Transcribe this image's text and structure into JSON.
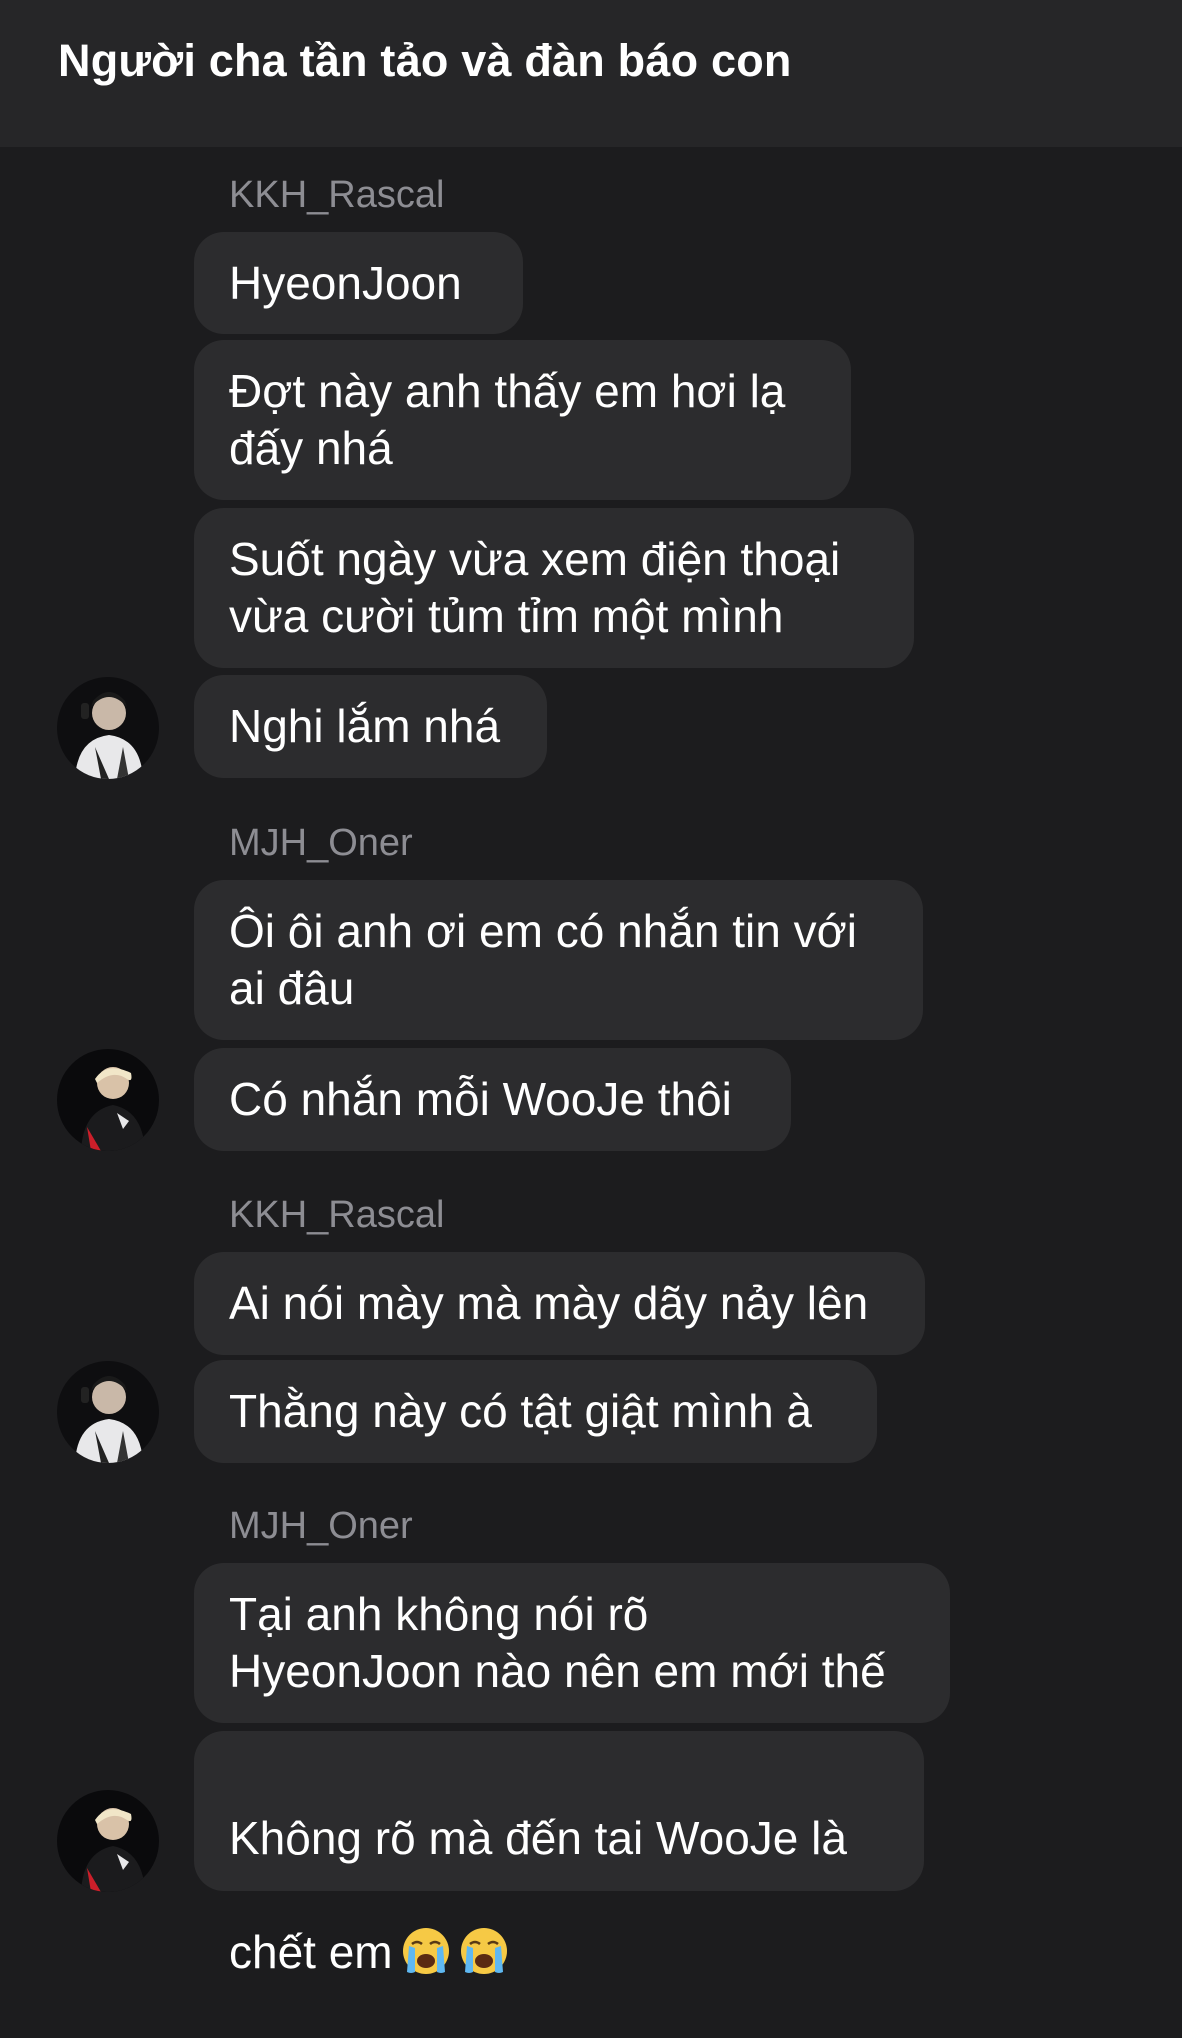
{
  "header": {
    "title": "Người cha tần tảo và đàn báo con"
  },
  "messages": {
    "group1": {
      "sender": "KKH_Rascal",
      "m1": "HyeonJoon",
      "m2": "Đợt này anh thấy em hơi lạ\nđấy nhá",
      "m3": "Suốt ngày vừa xem điện thoại\nvừa cười tủm tỉm một mình",
      "m4": "Nghi lắm nhá"
    },
    "group2": {
      "sender": "MJH_Oner",
      "m1": "Ôi ôi anh ơi em có nhắn tin với\nai đâu",
      "m2": "Có nhắn mỗi WooJe thôi"
    },
    "group3": {
      "sender": "KKH_Rascal",
      "m1": "Ai nói mày mà mày dãy nảy lên",
      "m2": "Thằng này có tật giật mình à"
    },
    "group4": {
      "sender": "MJH_Oner",
      "m1": "Tại anh không nói rõ\nHyeonJoon nào nên em mới thế",
      "m2_line1": "Không rõ mà đến tai WooJe là",
      "m2_line2": "chết em",
      "m2_emoji": "loudly-crying-face-icon"
    }
  },
  "colors": {
    "background": "#1c1c1e",
    "header": "#262628",
    "bubble": "#2c2c2e",
    "sender_name": "#8d8d93",
    "text": "#ffffff"
  }
}
